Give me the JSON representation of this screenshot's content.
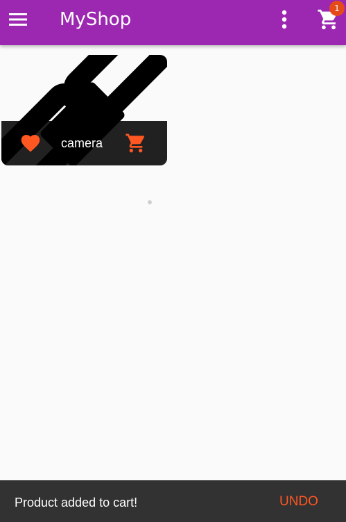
{
  "app_bar": {
    "title": "MyShop",
    "background_color": "#9c27b0",
    "menu_icon": "menu-icon",
    "more_icon": "more-vert-icon",
    "cart_icon": "shopping-cart-icon",
    "cart_badge_count": "1"
  },
  "products": [
    {
      "name": "camera",
      "image_icon": "broken-link-image-icon",
      "favorite_icon": "favorite-icon",
      "is_favorite": true,
      "add_to_cart_icon": "add-shopping-cart-icon",
      "accent_color": "#ff5722"
    }
  ],
  "snackbar": {
    "message": "Product added to cart!",
    "action_label": "UNDO",
    "action_color": "#ff5722",
    "background_color": "#323232"
  }
}
